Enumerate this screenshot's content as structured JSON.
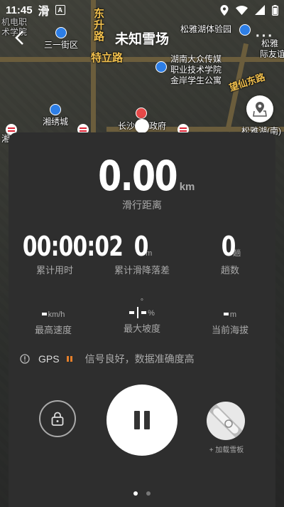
{
  "status_bar": {
    "time": "11:45",
    "app_glyph": "滑",
    "a_badge": "A"
  },
  "header": {
    "title": "未知雪场"
  },
  "map": {
    "labels": {
      "l1": "机电职",
      "l2": "术学院",
      "l3": "三一街区",
      "l4": "东",
      "l5": "升",
      "l6": "路",
      "l7": "松雅湖体验园",
      "l8": "松雅",
      "l9": "际友谊",
      "l10": "特立路",
      "l11": "湖南大众传媒",
      "l12": "职业技术学院",
      "l13": "金岸学生公寓",
      "l14": "望仙东路",
      "l15": "湘绣城",
      "l16": "长沙",
      "l17": "政府",
      "l18": "松雅湖(南)",
      "l19": "湘"
    }
  },
  "stats": {
    "distance_value": "0.00",
    "distance_unit": "km",
    "distance_label": "滑行距离",
    "time_value": "00:00:02",
    "time_label": "累计用时",
    "drop_value": "0",
    "drop_unit": "m",
    "drop_label": "累计滑降落差",
    "runs_value": "0",
    "runs_unit": "趟",
    "runs_label": "趟数",
    "max_speed_unit": "km/h",
    "max_speed_label": "最高速度",
    "max_slope_degree": "°",
    "max_slope_unit": "%",
    "max_slope_label": "最大坡度",
    "altitude_unit": "m",
    "altitude_label": "当前海拔"
  },
  "gps": {
    "label": "GPS",
    "status": "信号良好，数据准确度高"
  },
  "controls": {
    "board_label": "+ 加载雪板"
  }
}
